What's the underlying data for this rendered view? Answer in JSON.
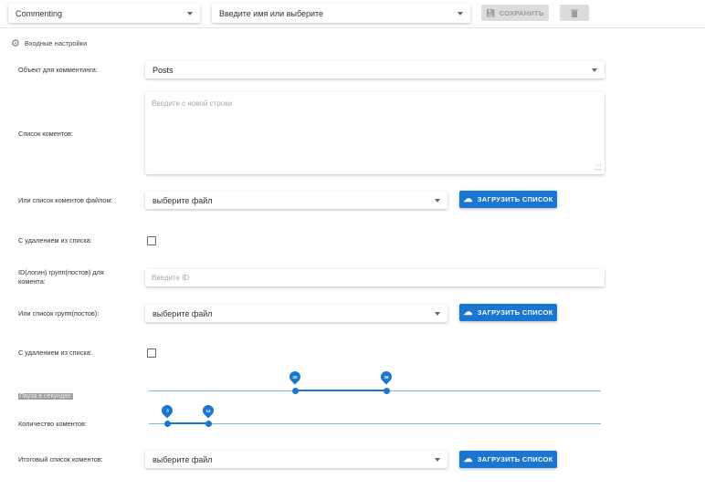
{
  "toolbar": {
    "mode_select": "Commenting",
    "account_placeholder": "Введите имя или выберите",
    "save_label": "СОХРАНИТЬ"
  },
  "section": {
    "title": "Входные настройки"
  },
  "fields": {
    "object_label": "Объект для комментинга:",
    "object_value": "Posts",
    "comments_label": "Список коментов:",
    "comments_placeholder": "Введите с новой строки",
    "comments_file_label": "Или список коментов файлом:",
    "comments_file_placeholder": "выберите файл",
    "upload_label": "ЗАГРУЗИТЬ СПИСОК",
    "delete_from_list_label": "С удалением из списка:",
    "group_ids_label": "ID(логин) групп(постов) для комента:",
    "group_ids_placeholder": "Введите ID",
    "groups_file_label": "Или список групп(постов):",
    "groups_file_placeholder": "выберите файл",
    "delete_from_list_label_2": "С удалением из списка:",
    "pause_label": "Пауза в секундах:",
    "pause_min": "20",
    "pause_max": "38",
    "pause_range_fraction": [
      0.32,
      0.52
    ],
    "count_label": "Количество коментов:",
    "count_min": "3",
    "count_max": "14",
    "count_range_fraction": [
      0.04,
      0.13
    ],
    "final_list_label": "Итоговый список коментов:",
    "final_file_placeholder": "выберите файл"
  },
  "colors": {
    "primary": "#1976d2",
    "disabled_bg": "#dcdcdc"
  }
}
